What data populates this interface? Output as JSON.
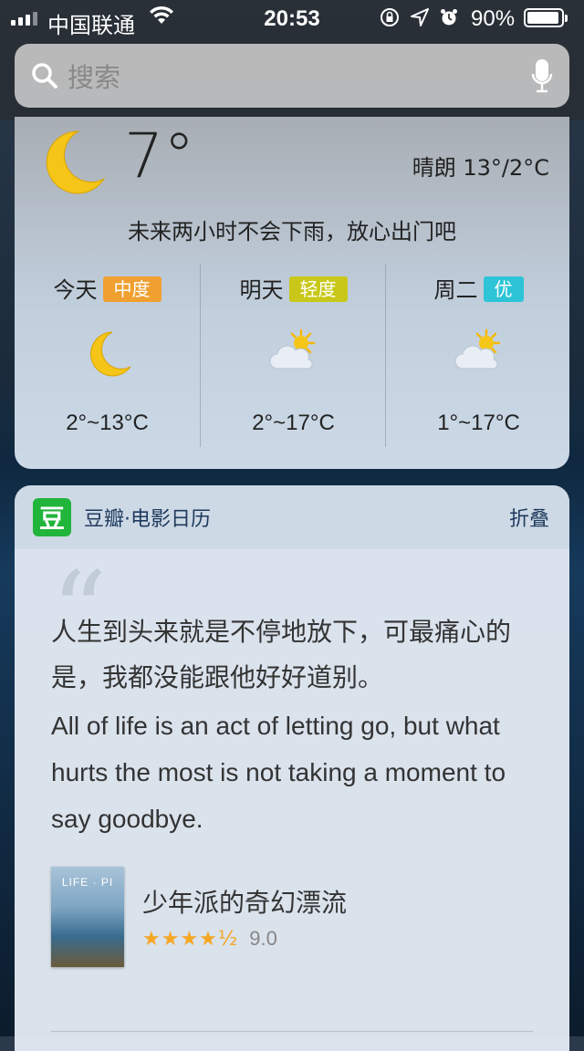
{
  "status": {
    "carrier": "中国联通",
    "time": "20:53",
    "battery": "90%",
    "battery_level": 0.9
  },
  "search": {
    "placeholder": "搜索"
  },
  "weather": {
    "current_temp": "7°",
    "condition": "晴朗 13°/2°C",
    "message": "未来两小时不会下雨，放心出门吧",
    "days": [
      {
        "name": "今天",
        "aqi": "中度",
        "aqi_color": "#f0a030",
        "icon": "moon-icon",
        "range": "2°~13°C"
      },
      {
        "name": "明天",
        "aqi": "轻度",
        "aqi_color": "#c9c81a",
        "icon": "partly-cloudy-icon",
        "range": "2°~17°C"
      },
      {
        "name": "周二",
        "aqi": "优",
        "aqi_color": "#2cc4d6",
        "icon": "partly-cloudy-icon",
        "range": "1°~17°C"
      }
    ]
  },
  "douban": {
    "logo": "豆",
    "title": "豆瓣·电影日历",
    "collapse": "折叠",
    "quote_cn": "人生到头来就是不停地放下，可最痛心的是，我都没能跟他好好道别。",
    "quote_en": "All of life is an act of letting go, but what hurts the most is not taking a moment to say goodbye.",
    "poster_title": "LIFE · PI",
    "movie_title": "少年派的奇幻漂流",
    "stars": "★★★★½",
    "score": "9.0"
  }
}
